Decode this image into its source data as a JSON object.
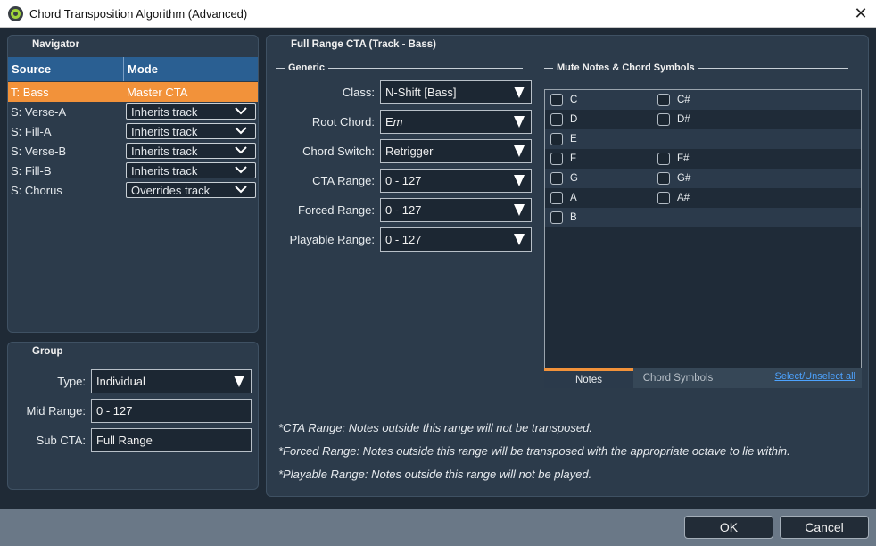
{
  "window": {
    "title": "Chord Transposition Algorithm (Advanced)",
    "close_glyph": "✕"
  },
  "navigator": {
    "title": "Navigator",
    "columns": [
      "Source",
      "Mode"
    ],
    "rows": [
      {
        "source": "T: Bass",
        "mode": "Master CTA",
        "active": true
      },
      {
        "source": "S: Verse-A",
        "mode": "Inherits track"
      },
      {
        "source": "S: Fill-A",
        "mode": "Inherits track"
      },
      {
        "source": "S: Verse-B",
        "mode": "Inherits track"
      },
      {
        "source": "S: Fill-B",
        "mode": "Inherits track"
      },
      {
        "source": "S: Chorus",
        "mode": "Overrides track"
      }
    ]
  },
  "group": {
    "title": "Group",
    "type_label": "Type:",
    "type_value": "Individual",
    "mid_label": "Mid Range:",
    "mid_value": "0 - 127",
    "sub_label": "Sub CTA:",
    "sub_value": "Full Range"
  },
  "full_range": {
    "title": "Full Range CTA (Track - Bass)",
    "generic_title": "Generic",
    "fields": [
      {
        "label": "Class:",
        "value": "N-Shift [Bass]"
      },
      {
        "label": "Root Chord:",
        "value": "E𝑚"
      },
      {
        "label": "Chord Switch:",
        "value": "Retrigger"
      },
      {
        "label": "CTA Range:",
        "value": "0 - 127"
      },
      {
        "label": "Forced Range:",
        "value": "0 - 127"
      },
      {
        "label": "Playable Range:",
        "value": "0 - 127"
      }
    ],
    "mute_title": "Mute Notes & Chord Symbols",
    "notes": {
      "c": "C",
      "cs": "C#",
      "d": "D",
      "ds": "D#",
      "e": "E",
      "f": "F",
      "fs": "F#",
      "g": "G",
      "gs": "G#",
      "a": "A",
      "as": "A#",
      "b": "B"
    },
    "tabs": {
      "notes": "Notes",
      "chord_symbols": "Chord Symbols",
      "select_link": "Select/Unselect all"
    },
    "footnotes": [
      "*CTA Range: Notes outside this range will not be transposed.",
      "*Forced Range: Notes outside this range will be transposed with the appropriate octave to lie within.",
      "*Playable Range: Notes outside this range will not be played."
    ]
  },
  "buttons": {
    "ok": "OK",
    "cancel": "Cancel"
  },
  "colors": {
    "accent": "#f2923a",
    "header_blue": "#2a5f92",
    "link": "#4da3ff"
  }
}
